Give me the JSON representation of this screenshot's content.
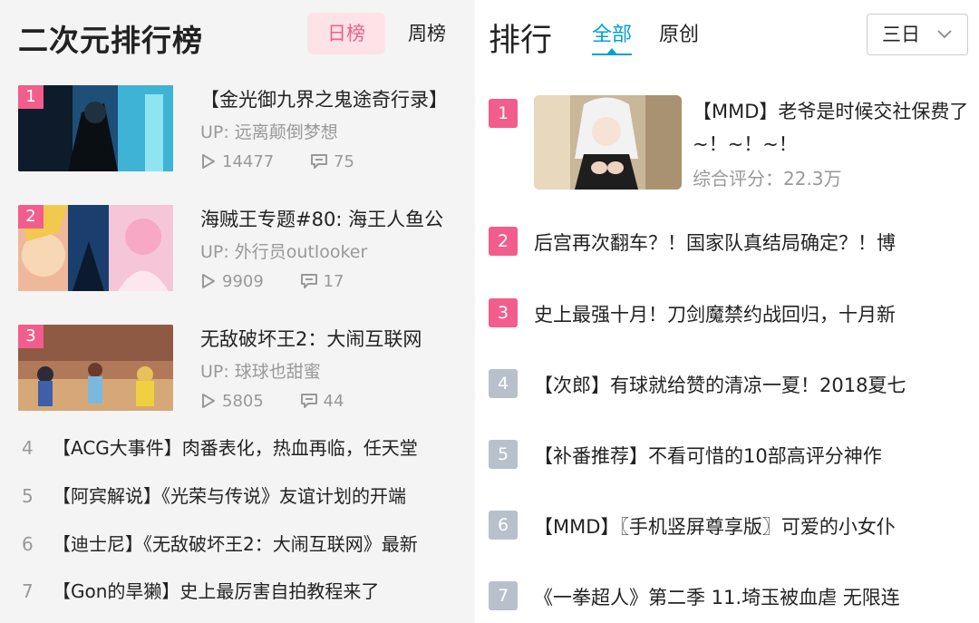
{
  "left_panel": {
    "title": "二次元排行榜",
    "tabs": {
      "day": "日榜",
      "week": "周榜"
    },
    "featured": [
      {
        "rank": "1",
        "title": "【金光御九界之鬼途奇行录】",
        "up": "UP: 远离颠倒梦想",
        "plays": "14477",
        "comments": "75"
      },
      {
        "rank": "2",
        "title": "海贼王专题#80: 海王人鱼公",
        "up": "UP: 外行员outlooker",
        "plays": "9909",
        "comments": "17"
      },
      {
        "rank": "3",
        "title": "无敌破坏王2：大闹互联网",
        "up": "UP: 球球也甜蜜",
        "plays": "5805",
        "comments": "44"
      }
    ],
    "list": [
      {
        "rank": "4",
        "title": "【ACG大事件】肉番表化，热血再临，任天堂"
      },
      {
        "rank": "5",
        "title": "【阿宾解说】《光荣与传说》友谊计划的开端"
      },
      {
        "rank": "6",
        "title": "【迪士尼】《无敌破坏王2：大闹互联网》最新"
      },
      {
        "rank": "7",
        "title": "【Gon的旱獭】史上最厉害自拍教程来了"
      }
    ]
  },
  "right_panel": {
    "title": "排行",
    "tabs": {
      "all": "全部",
      "original": "原创"
    },
    "dropdown": "三日",
    "featured": {
      "rank": "1",
      "title": "【MMD】老爷是时候交社保费了~！~！~！",
      "score": "综合评分：22.3万"
    },
    "list": [
      {
        "rank": "2",
        "title": "后宫再次翻车？！国家队真结局确定？！博"
      },
      {
        "rank": "3",
        "title": "史上最强十月！刀剑魔禁约战回归，十月新"
      },
      {
        "rank": "4",
        "title": "【次郎】有球就给赞的清凉一夏！2018夏七"
      },
      {
        "rank": "5",
        "title": "【补番推荐】不看可惜的10部高评分神作"
      },
      {
        "rank": "6",
        "title": "【MMD】〖手机竖屏尊享版〗可爱的小女仆"
      },
      {
        "rank": "7",
        "title": "《一拳超人》第二季 11.埼玉被血虐 无限连"
      }
    ]
  },
  "colors": {
    "accent_pink": "#f25d8e",
    "accent_blue": "#00a1d6",
    "rank_gray": "#b8c0cc",
    "tab_active_bg": "#fde3e8"
  }
}
